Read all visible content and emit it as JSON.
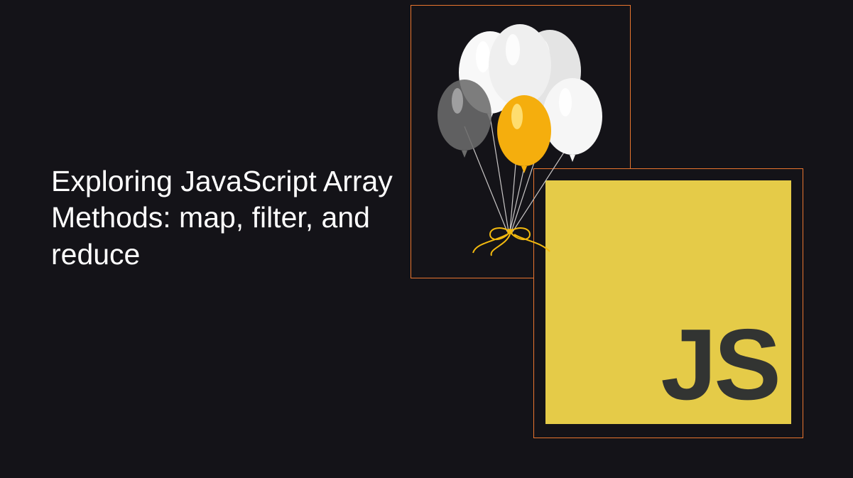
{
  "title": "Exploring JavaScript Array Methods: map, filter, and reduce",
  "js_label": "JS",
  "colors": {
    "background": "#141318",
    "border": "#e9752f",
    "js_bg": "#e5cb48",
    "js_text": "#323432",
    "title_text": "#ffffff"
  },
  "graphics": {
    "left_box": "balloons-illustration",
    "right_box": "javascript-logo"
  }
}
